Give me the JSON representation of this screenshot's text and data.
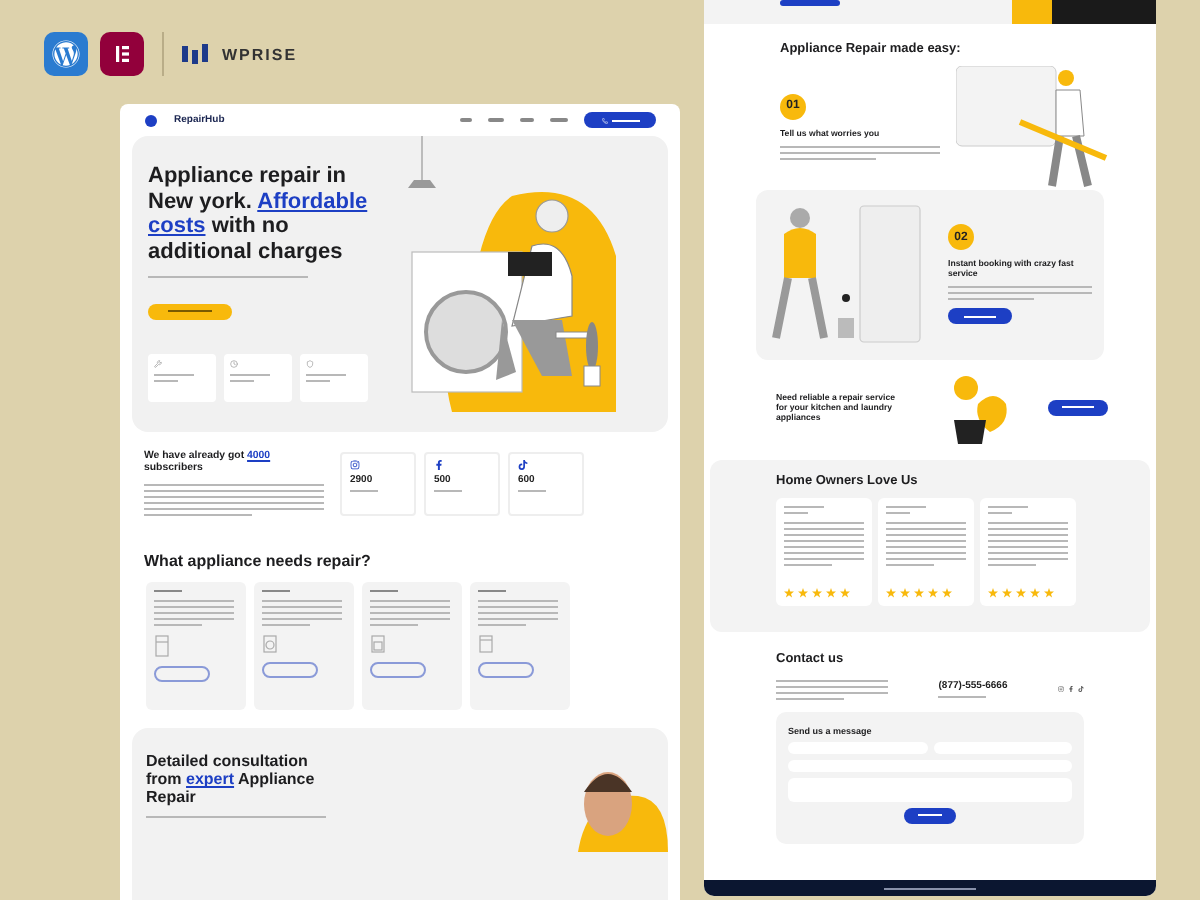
{
  "brand_bar": {
    "logo_text": "WPRISE"
  },
  "site": {
    "logo": "RepairHub",
    "hero": {
      "title_before": "Appliance repair in New york.",
      "highlight": "Affordable costs",
      "title_after": "with no additional charges"
    },
    "features": [
      {
        "kind": "wrench"
      },
      {
        "kind": "clock"
      },
      {
        "kind": "shield"
      }
    ],
    "subscribers": {
      "title_before": "We have already got",
      "highlight": "4000",
      "title_after": "subscribers"
    },
    "stats": [
      {
        "kind": "instagram",
        "value": "2900"
      },
      {
        "kind": "facebook",
        "value": "500"
      },
      {
        "kind": "tiktok",
        "value": "600"
      }
    ],
    "appliances": {
      "heading": "What appliance needs repair?",
      "cards": [
        {
          "kind": "fridge"
        },
        {
          "kind": "washer"
        },
        {
          "kind": "oven"
        },
        {
          "kind": "dishwasher"
        }
      ]
    },
    "consultation": {
      "title_before": "Detailed consultation from",
      "highlight": "expert",
      "title_after": "Appliance Repair"
    }
  },
  "right_page": {
    "heading": "Appliance Repair made easy:",
    "steps": [
      {
        "number": "01",
        "title": "Tell us what worries you"
      },
      {
        "number": "02",
        "title": "Instant booking with crazy fast service"
      }
    ],
    "cta": "Need reliable a repair service for your kitchen and laundry appliances",
    "reviews": {
      "heading": "Home Owners Love Us",
      "items": [
        {
          "stars": 5
        },
        {
          "stars": 5
        },
        {
          "stars": 5
        }
      ]
    },
    "contact": {
      "heading": "Contact us",
      "phone": "(877)-555-6666",
      "form_title": "Send us a message"
    }
  }
}
